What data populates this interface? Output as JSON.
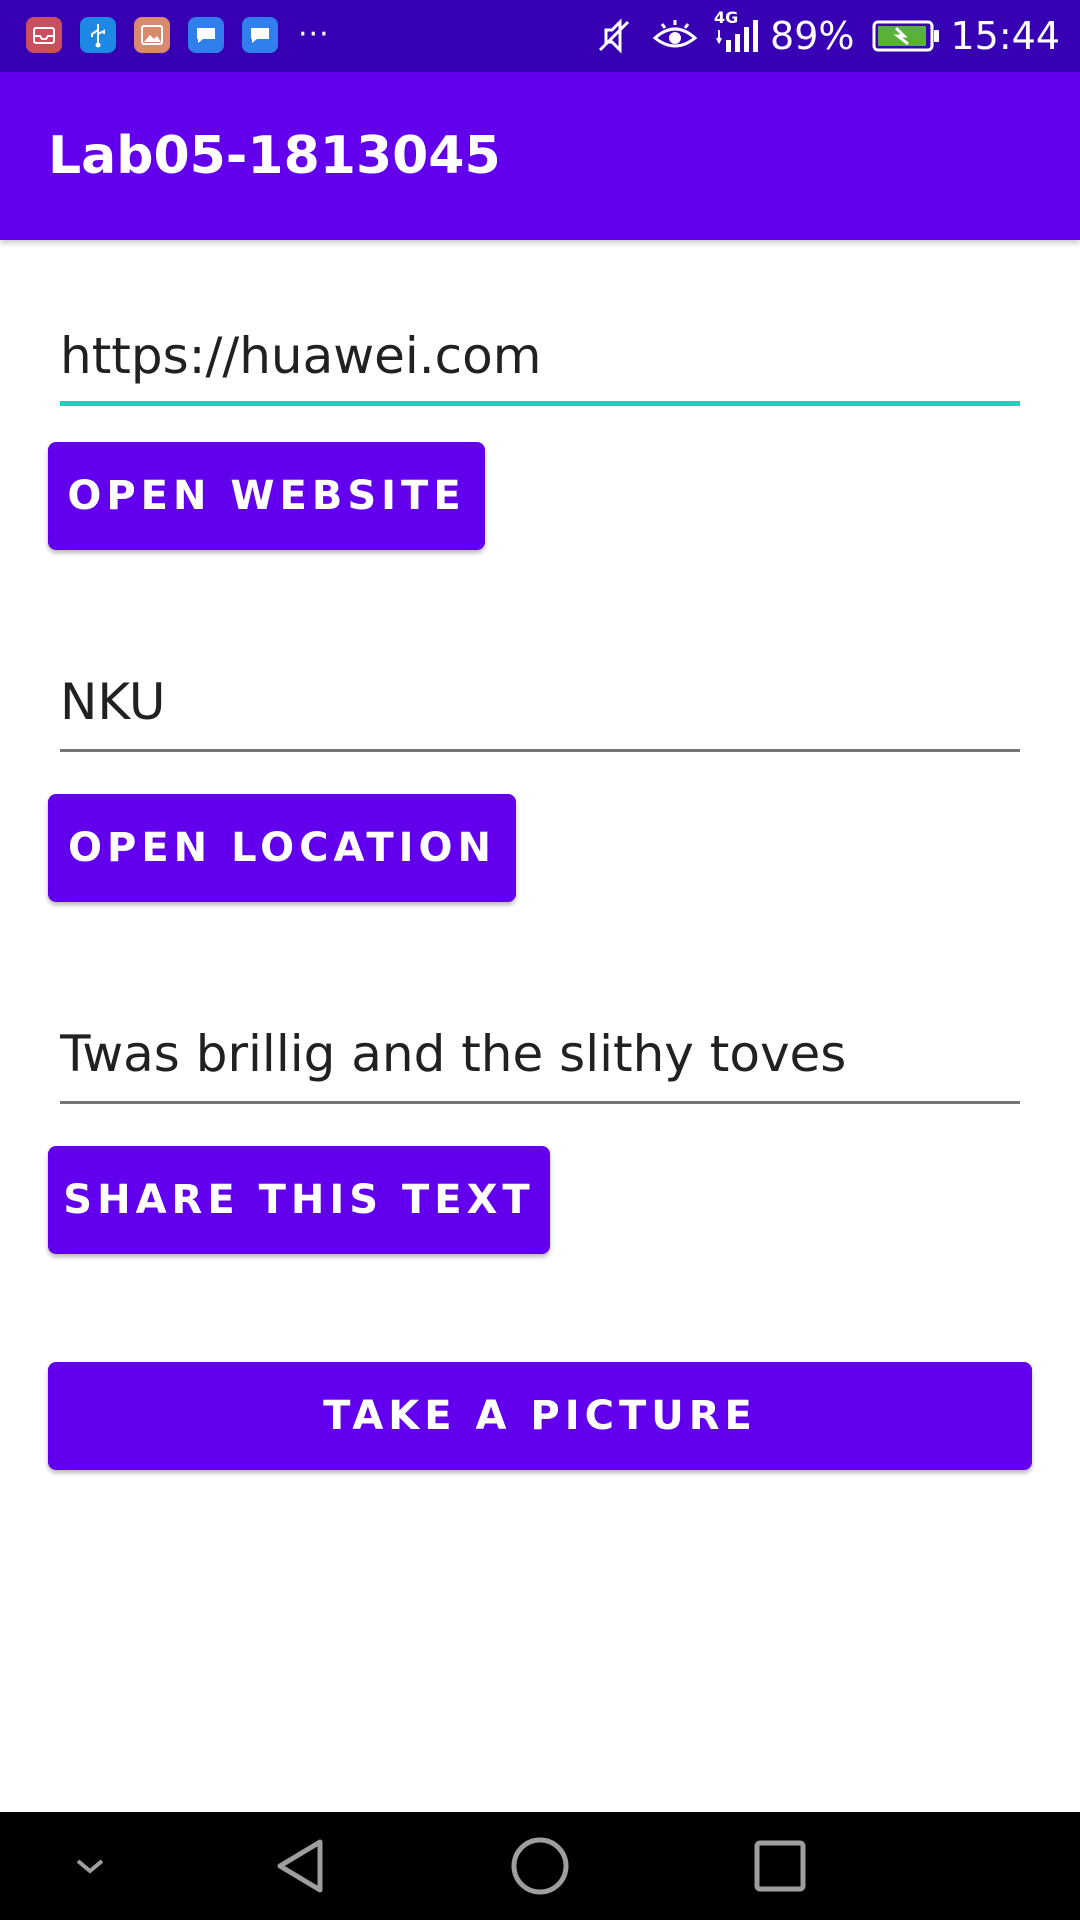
{
  "status_bar": {
    "notification_icons": [
      "mail-icon",
      "usb-icon",
      "gallery-icon",
      "chat-icon",
      "chat-icon"
    ],
    "more_label": "···",
    "network_label": "4G",
    "battery_percent": "89%",
    "time": "15:44"
  },
  "app_bar": {
    "title": "Lab05-1813045"
  },
  "website": {
    "value": "https://huawei.com",
    "button_label": "OPEN WEBSITE"
  },
  "location": {
    "value": "NKU",
    "button_label": "OPEN LOCATION"
  },
  "share": {
    "value": "Twas brillig and the slithy toves",
    "button_label": "SHARE THIS TEXT"
  },
  "camera": {
    "button_label": "TAKE A PICTURE"
  },
  "colors": {
    "status_bar": "#3700B3",
    "primary": "#6200EE",
    "focus_underline": "#18D3C0",
    "text": "#212121"
  }
}
